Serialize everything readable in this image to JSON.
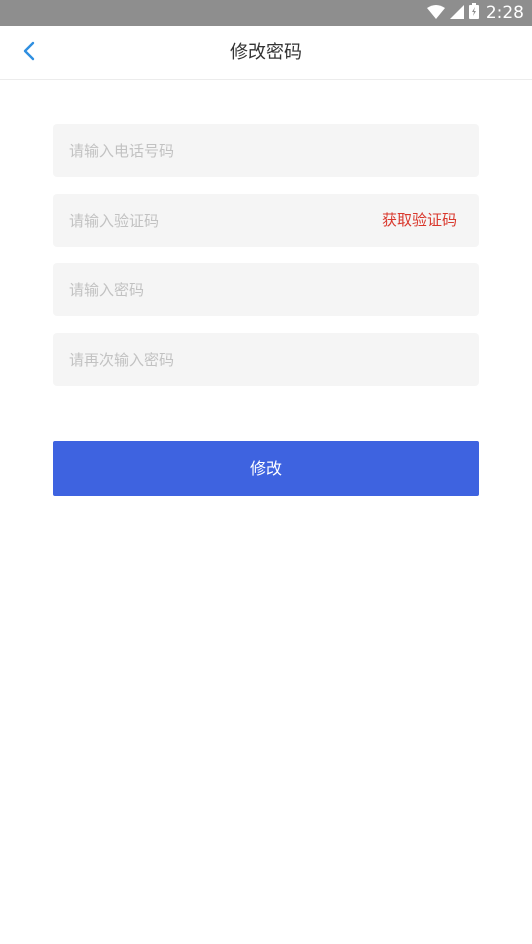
{
  "status_bar": {
    "time": "2:28",
    "icons": [
      "wifi-icon",
      "signal-icon",
      "battery-icon"
    ]
  },
  "header": {
    "back_icon": "chevron-left-icon",
    "title": "修改密码"
  },
  "form": {
    "phone_placeholder": "请输入电话号码",
    "code_placeholder": "请输入验证码",
    "get_code_label": "获取验证码",
    "password_placeholder": "请输入密码",
    "confirm_password_placeholder": "请再次输入密码",
    "submit_label": "修改"
  },
  "colors": {
    "accent": "#3e63e0",
    "link_red": "#d9372c",
    "back_icon": "#2f8fe0",
    "status_bar": "#8e8e8e"
  }
}
